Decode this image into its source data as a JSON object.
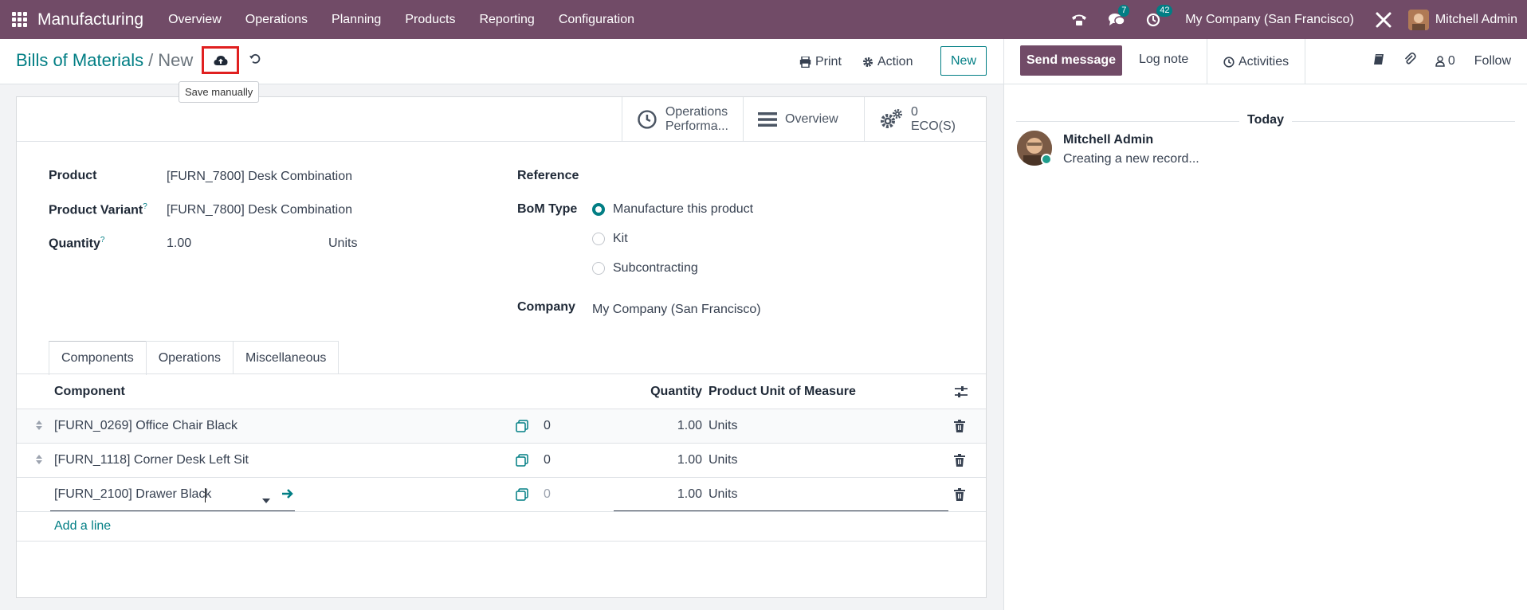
{
  "navbar": {
    "app_name": "Manufacturing",
    "menu": [
      "Overview",
      "Operations",
      "Planning",
      "Products",
      "Reporting",
      "Configuration"
    ],
    "messages_badge": "7",
    "activities_badge": "42",
    "company": "My Company (San Francisco)",
    "user": "Mitchell Admin"
  },
  "control_panel": {
    "breadcrumb_parent": "Bills of Materials",
    "breadcrumb_separator": "/",
    "breadcrumb_current": "New",
    "tooltip": "Save manually",
    "print_label": "Print",
    "action_label": "Action",
    "new_label": "New"
  },
  "smart_buttons": {
    "operations_line1": "Operations",
    "operations_line2": "Performa...",
    "overview": "Overview",
    "eco_count": "0",
    "eco_label": "ECO(S)"
  },
  "form": {
    "product_label": "Product",
    "product_value": "[FURN_7800] Desk Combination",
    "variant_label": "Product Variant",
    "variant_value": "[FURN_7800] Desk Combination",
    "quantity_label": "Quantity",
    "quantity_value": "1.00",
    "quantity_uom": "Units",
    "help_mark": "?",
    "reference_label": "Reference",
    "bom_type_label": "BoM Type",
    "bom_types": [
      "Manufacture this product",
      "Kit",
      "Subcontracting"
    ],
    "bom_type_selected": "Manufacture this product",
    "company_label": "Company",
    "company_value": "My Company (San Francisco)"
  },
  "tabs": [
    "Components",
    "Operations",
    "Miscellaneous"
  ],
  "components": {
    "headers": {
      "component": "Component",
      "quantity": "Quantity",
      "uom": "Product Unit of Measure"
    },
    "rows": [
      {
        "component": "[FURN_0269] Office Chair Black",
        "forecast": "0",
        "quantity": "1.00",
        "uom": "Units"
      },
      {
        "component": "[FURN_1118] Corner Desk Left Sit",
        "forecast": "0",
        "quantity": "1.00",
        "uom": "Units"
      },
      {
        "component": "[FURN_2100] Drawer Black",
        "forecast": "0",
        "quantity": "1.00",
        "uom": "Units"
      }
    ],
    "add_line": "Add a line"
  },
  "chatter": {
    "send_message": "Send message",
    "log_note": "Log note",
    "activities": "Activities",
    "attachments_count": "0",
    "follow": "Follow",
    "date_separator": "Today",
    "author": "Mitchell Admin",
    "message": "Creating a new record..."
  },
  "colors": {
    "brand": "#714b67",
    "accent": "#017e84",
    "save_highlight": "#e02020"
  }
}
